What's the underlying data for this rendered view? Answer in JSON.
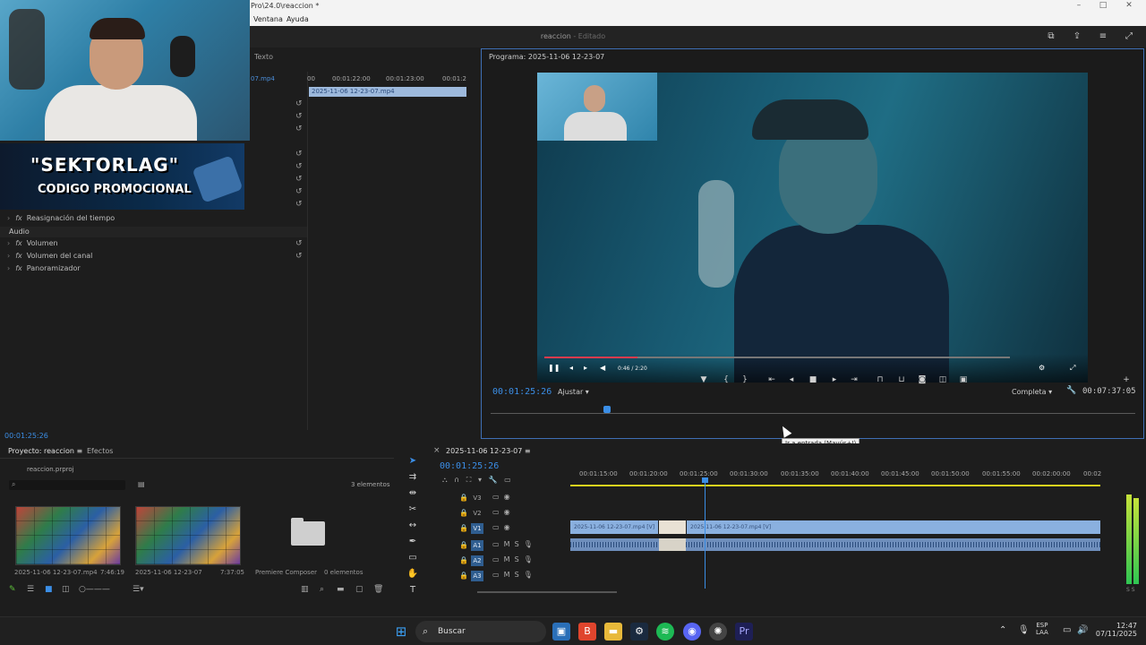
{
  "window": {
    "title": "Pro\\24.0\\reaccion *",
    "controls": [
      "–",
      "□",
      "✕"
    ]
  },
  "menu": [
    "Ventana",
    "Ayuda"
  ],
  "header": {
    "project_name": "reaccion",
    "separator": " - ",
    "status": "Editado"
  },
  "webcam_overlay": {
    "line1": "\"SEKTORLAG\"",
    "line2": "CODIGO PROMOCIONAL"
  },
  "effect_controls": {
    "tab_label": "Texto",
    "clip_name": "07.mp4",
    "time_ticks": [
      "00",
      "00:01:22:00",
      "00:01:23:00",
      "00:01:2"
    ],
    "track_clip": "2025-11-06 12-23-07.mp4",
    "rows": [
      {
        "label": "Reasignación del tiempo",
        "has_fx": true
      },
      {
        "label": "Volumen",
        "has_fx": true
      },
      {
        "label": "Volumen del canal",
        "has_fx": true
      },
      {
        "label": "Panoramizador",
        "has_fx": true
      }
    ],
    "audio_header": "Audio",
    "timecode": "00:01:25:26"
  },
  "program_monitor": {
    "title": "Programa: 2025-11-06 12-23-07",
    "timecode": "00:01:25:26",
    "fit": "Ajustar",
    "resolution": "Completa",
    "duration": "00:07:37:05",
    "video_time": "0:46 / 2:20",
    "video_progress": 0.2,
    "playhead_fraction": 0.18
  },
  "tooltip": "Ir a entrada (Mayús+I)",
  "project_panel": {
    "tabs": [
      "Proyecto: reaccion",
      "Efectos"
    ],
    "file": "reaccion.prproj",
    "count": "3 elementos",
    "items": [
      {
        "name": "2025-11-06 12-23-07.mp4",
        "duration": "7:46:19"
      },
      {
        "name": "2025-11-06 12-23-07",
        "duration": "7:37:05"
      },
      {
        "name": "Premiere Composer",
        "duration": "0 elementos"
      }
    ]
  },
  "timeline": {
    "sequence": "2025-11-06 12-23-07",
    "timecode": "00:01:25:26",
    "ruler": [
      "00:01:15:00",
      "00:01:20:00",
      "00:01:25:00",
      "00:01:30:00",
      "00:01:35:00",
      "00:01:40:00",
      "00:01:45:00",
      "00:01:50:00",
      "00:01:55:00",
      "00:02:00:00",
      "00:02"
    ],
    "tracks": [
      {
        "id": "V3",
        "type": "video"
      },
      {
        "id": "V2",
        "type": "video"
      },
      {
        "id": "V1",
        "type": "video"
      },
      {
        "id": "A1",
        "type": "audio"
      },
      {
        "id": "A2",
        "type": "audio"
      },
      {
        "id": "A3",
        "type": "audio"
      }
    ],
    "clip_label_1": "2025-11-06 12-23-07.mp4 [V]",
    "clip_label_2": "2025-11-06 12-23-07.mp4 [V]"
  },
  "taskbar": {
    "search_placeholder": "Buscar",
    "lang": "ESP",
    "lang2": "LAA",
    "time": "12:47",
    "date": "07/11/2025"
  }
}
